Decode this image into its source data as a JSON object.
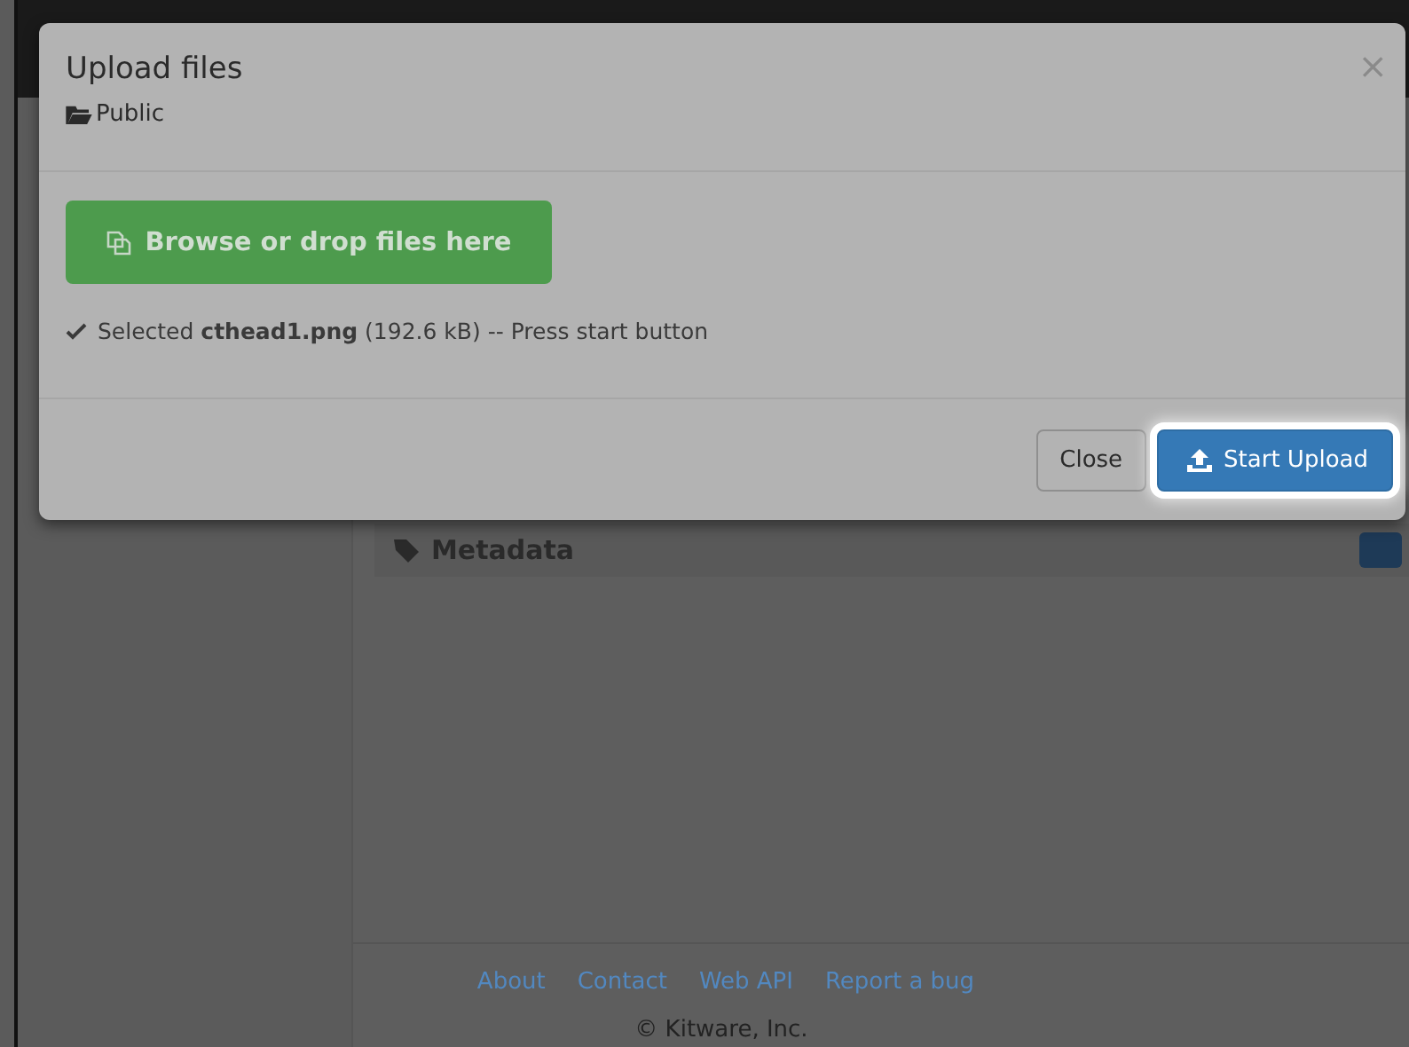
{
  "background": {
    "section_title": "Metadata",
    "footer_links": [
      "About",
      "Contact",
      "Web API",
      "Report a bug"
    ],
    "copyright": "© Kitware, Inc."
  },
  "dialog": {
    "title": "Upload files",
    "folder": "Public",
    "close_glyph": "×",
    "browse_button": "Browse or drop files here",
    "status": "Selected **cthead1.png** (192.6 kB) -- Press start button",
    "buttons": [
      {
        "label": "Close",
        "kind": "default",
        "highlighted": false
      },
      {
        "label": "Start Upload",
        "kind": "primary",
        "highlighted": true
      }
    ]
  }
}
